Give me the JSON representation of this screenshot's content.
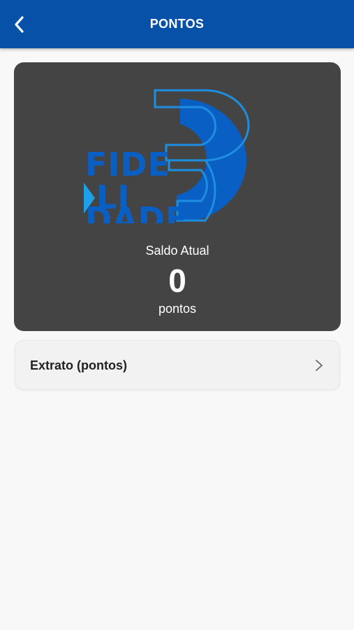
{
  "header": {
    "title": "PONTOS",
    "back_icon": "chevron-left-icon",
    "background": "#0752a8"
  },
  "card": {
    "background": "#444444",
    "logo": {
      "text_lines": [
        "FIDE",
        "LI",
        "DADE"
      ],
      "brand_colors": [
        "#0a5fc4",
        "#1e8fe0"
      ]
    },
    "saldo_label": "Saldo Atual",
    "saldo_value": "0",
    "saldo_unit": "pontos"
  },
  "menu": {
    "items": [
      {
        "label": "Extrato (pontos)",
        "icon": "chevron-right-icon"
      }
    ]
  }
}
